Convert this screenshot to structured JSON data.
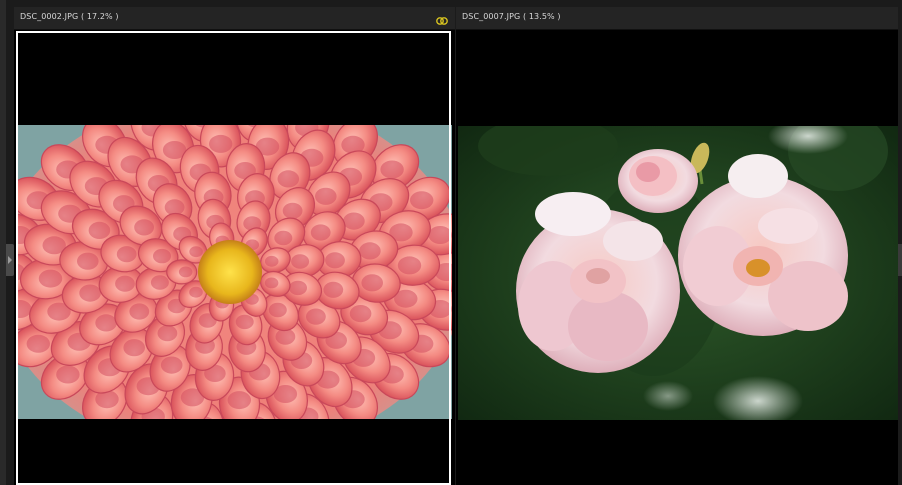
{
  "left_pane": {
    "title": "DSC_0002.JPG ( 17.2% )",
    "sync_icon": "link-sync-icon",
    "sync_color": "#d8c420"
  },
  "right_pane": {
    "title": "DSC_0007.JPG ( 13.5% )"
  },
  "colors": {
    "background": "#000000",
    "titlebar": "#242424",
    "selection_border": "#ffffff"
  }
}
